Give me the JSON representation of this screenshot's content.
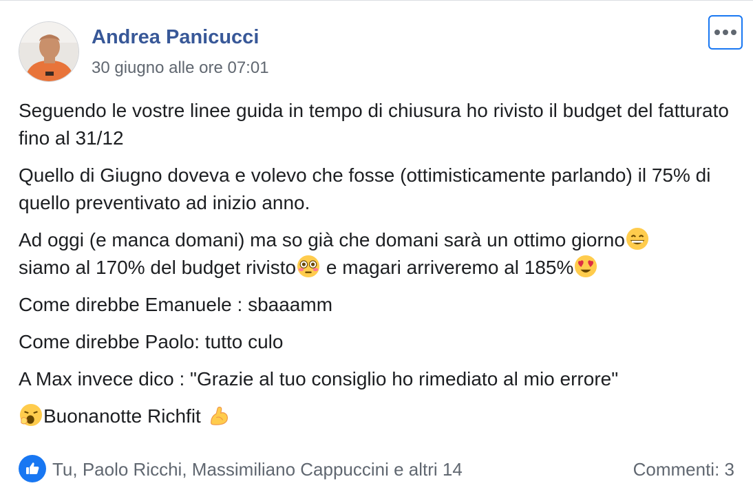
{
  "post": {
    "author": "Andrea Panicucci",
    "timestamp": "30 giugno alle ore 07:01",
    "more_icon": "more-horizontal-icon",
    "paragraphs": {
      "p1": "Seguendo le vostre linee guida in tempo di chiusura ho rivisto il budget del fatturato fino al 31/12",
      "p2": "Quello di Giugno doveva e volevo che fosse (ottimisticamente parlando) il 75% di quello preventivato ad inizio anno.",
      "p3a": "Ad oggi (e manca domani) ma so già che domani sarà un ottimo giorno",
      "p3b": "siamo al 170% del budget rivisto",
      "p3c": " e magari arriveremo al 185%",
      "p4": "Come direbbe Emanuele : sbaaamm",
      "p5": "Come direbbe Paolo: tutto culo",
      "p6": "A Max invece dico : \"Grazie al tuo consiglio ho rimediato al mio errore\"",
      "p7": "Buonanotte Richfit "
    },
    "emojis": [
      "grinning-face-icon",
      "flushed-face-icon",
      "heart-eyes-face-icon",
      "yawning-face-icon",
      "flexed-biceps-icon"
    ]
  },
  "footer": {
    "reaction_icon": "like-icon",
    "reactors_text": "Tu, Paolo Ricchi, Massimiliano Cappuccini e altri 14",
    "comments_text": "Commenti: 3"
  },
  "colors": {
    "author": "#385898",
    "secondary_text": "#606770",
    "accent": "#1877f2"
  }
}
